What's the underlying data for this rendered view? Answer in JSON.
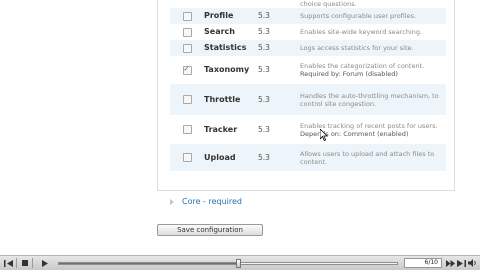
{
  "modules": {
    "top_partial_text": "choice questions.",
    "rows": [
      {
        "name": "Profile",
        "version": "5.3",
        "description": "Supports configurable user profiles.",
        "checked": false
      },
      {
        "name": "Search",
        "version": "5.3",
        "description": "Enables site-wide keyword searching.",
        "checked": false
      },
      {
        "name": "Statistics",
        "version": "5.3",
        "description": "Logs access statistics for your site.",
        "checked": false
      },
      {
        "name": "Taxonomy",
        "version": "5.3",
        "description": "Enables the categorization of content.",
        "req_label": "Required by:",
        "req_value": "Forum",
        "req_status": "(disabled)",
        "checked": true
      },
      {
        "name": "Throttle",
        "version": "5.3",
        "description": "Handles the auto-throttling mechanism, to control site congestion.",
        "checked": false
      },
      {
        "name": "Tracker",
        "version": "5.3",
        "description": "Enables tracking of recent posts for users.",
        "req_label": "Depends on:",
        "req_value": "Comment",
        "req_status": "(enabled)",
        "checked": false
      },
      {
        "name": "Upload",
        "version": "5.3",
        "description": "Allows users to upload and attach files to content.",
        "checked": false
      }
    ]
  },
  "core_fieldset": {
    "label": "Core - required"
  },
  "actions": {
    "save_label": "Save configuration"
  },
  "player": {
    "counter": "6/10",
    "progress": 0.53,
    "icons": [
      "skip-back-icon",
      "stop-icon",
      "play-icon",
      "step-forward-icon",
      "skip-forward-icon",
      "volume-icon"
    ]
  }
}
